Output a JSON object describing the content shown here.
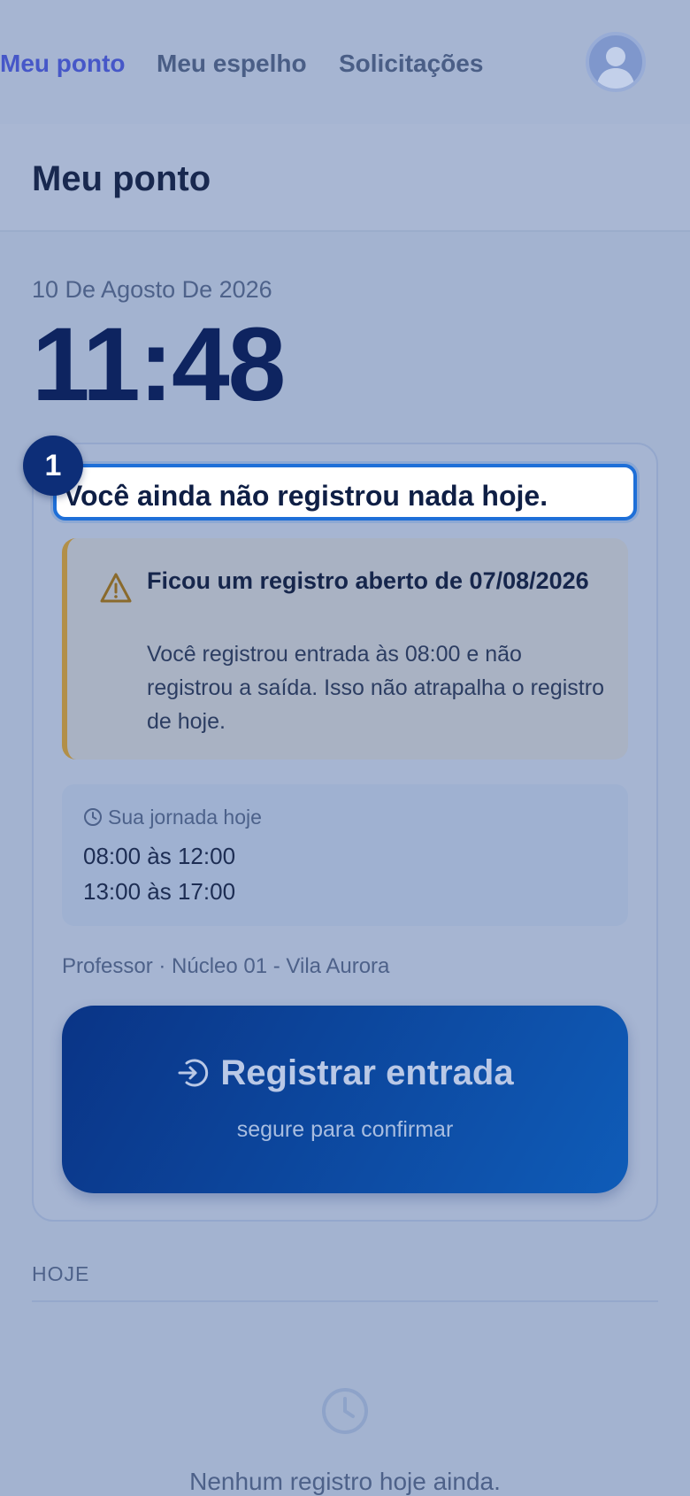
{
  "nav": {
    "items": [
      {
        "label": "Meu ponto",
        "active": true
      },
      {
        "label": "Meu espelho",
        "active": false
      },
      {
        "label": "Solicitações",
        "active": false
      }
    ],
    "avatar_icon": "user-avatar-icon"
  },
  "page": {
    "title": "Meu ponto"
  },
  "clock": {
    "date": "10 De Agosto De 2026",
    "time": "11:48"
  },
  "status": {
    "step": "1",
    "message": "Você ainda não registrou nada hoje."
  },
  "warning": {
    "icon": "warning-triangle-icon",
    "title": "Ficou um registro aberto de 07/08/2026",
    "body": "Você registrou entrada às 08:00 e não registrou a saída. Isso não atrapalha o registro de hoje."
  },
  "journey": {
    "label": "Sua jornada hoje",
    "icon": "clock-icon",
    "shifts": [
      "08:00 às 12:00",
      "13:00 às 17:00"
    ]
  },
  "role": "Professor · Núcleo 01 - Vila Aurora",
  "punch": {
    "label": "Registrar entrada",
    "sublabel": "segure para confirmar",
    "icon": "login-arrow-icon"
  },
  "today": {
    "label": "HOJE",
    "empty_message": "Nenhum registro hoje ainda.",
    "empty_icon": "clock-icon"
  },
  "colors": {
    "accent": "#4657c8",
    "primary": "#0d2e78",
    "warning": "#b28f48",
    "focus": "#1e6fd8"
  }
}
